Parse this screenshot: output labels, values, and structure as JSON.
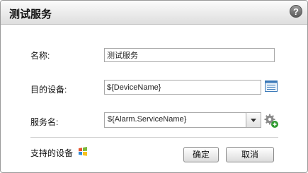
{
  "dialog": {
    "title": "测试服务",
    "help_label": "?"
  },
  "fields": {
    "name_label": "名称:",
    "name_value": "测试服务",
    "target_label": "目的设备:",
    "target_value": "${DeviceName}",
    "service_label": "服务名:",
    "service_value": "${Alarm.ServiceName}"
  },
  "footer": {
    "support_label": "支持的设备",
    "ok_label": "确定",
    "cancel_label": "取消"
  },
  "icons": {
    "help": "question-icon",
    "list": "device-list-icon",
    "gear": "gear-add-icon",
    "windows": "windows-logo-icon"
  }
}
